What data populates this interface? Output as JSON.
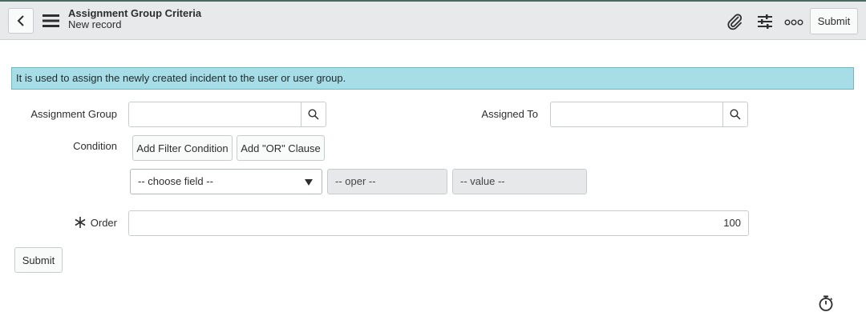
{
  "header": {
    "title": "Assignment Group Criteria",
    "subtitle": "New record",
    "submit_label": "Submit",
    "icons": [
      "chevron-left-icon",
      "hamburger-menu-icon",
      "paperclip-icon",
      "settings-sliders-icon",
      "more-options-icon"
    ]
  },
  "info_message": "It is used to assign the newly created incident to the user or user group.",
  "form": {
    "assignment_group": {
      "label": "Assignment Group",
      "value": ""
    },
    "assigned_to": {
      "label": "Assigned To",
      "value": ""
    },
    "condition": {
      "label": "Condition",
      "add_filter_label": "Add Filter Condition",
      "add_or_label": "Add \"OR\" Clause",
      "field_placeholder": "-- choose field --",
      "oper_placeholder": "-- oper --",
      "value_placeholder": "-- value --"
    },
    "order": {
      "label": "Order",
      "value": "100",
      "mandatory": true
    },
    "submit_label": "Submit"
  }
}
